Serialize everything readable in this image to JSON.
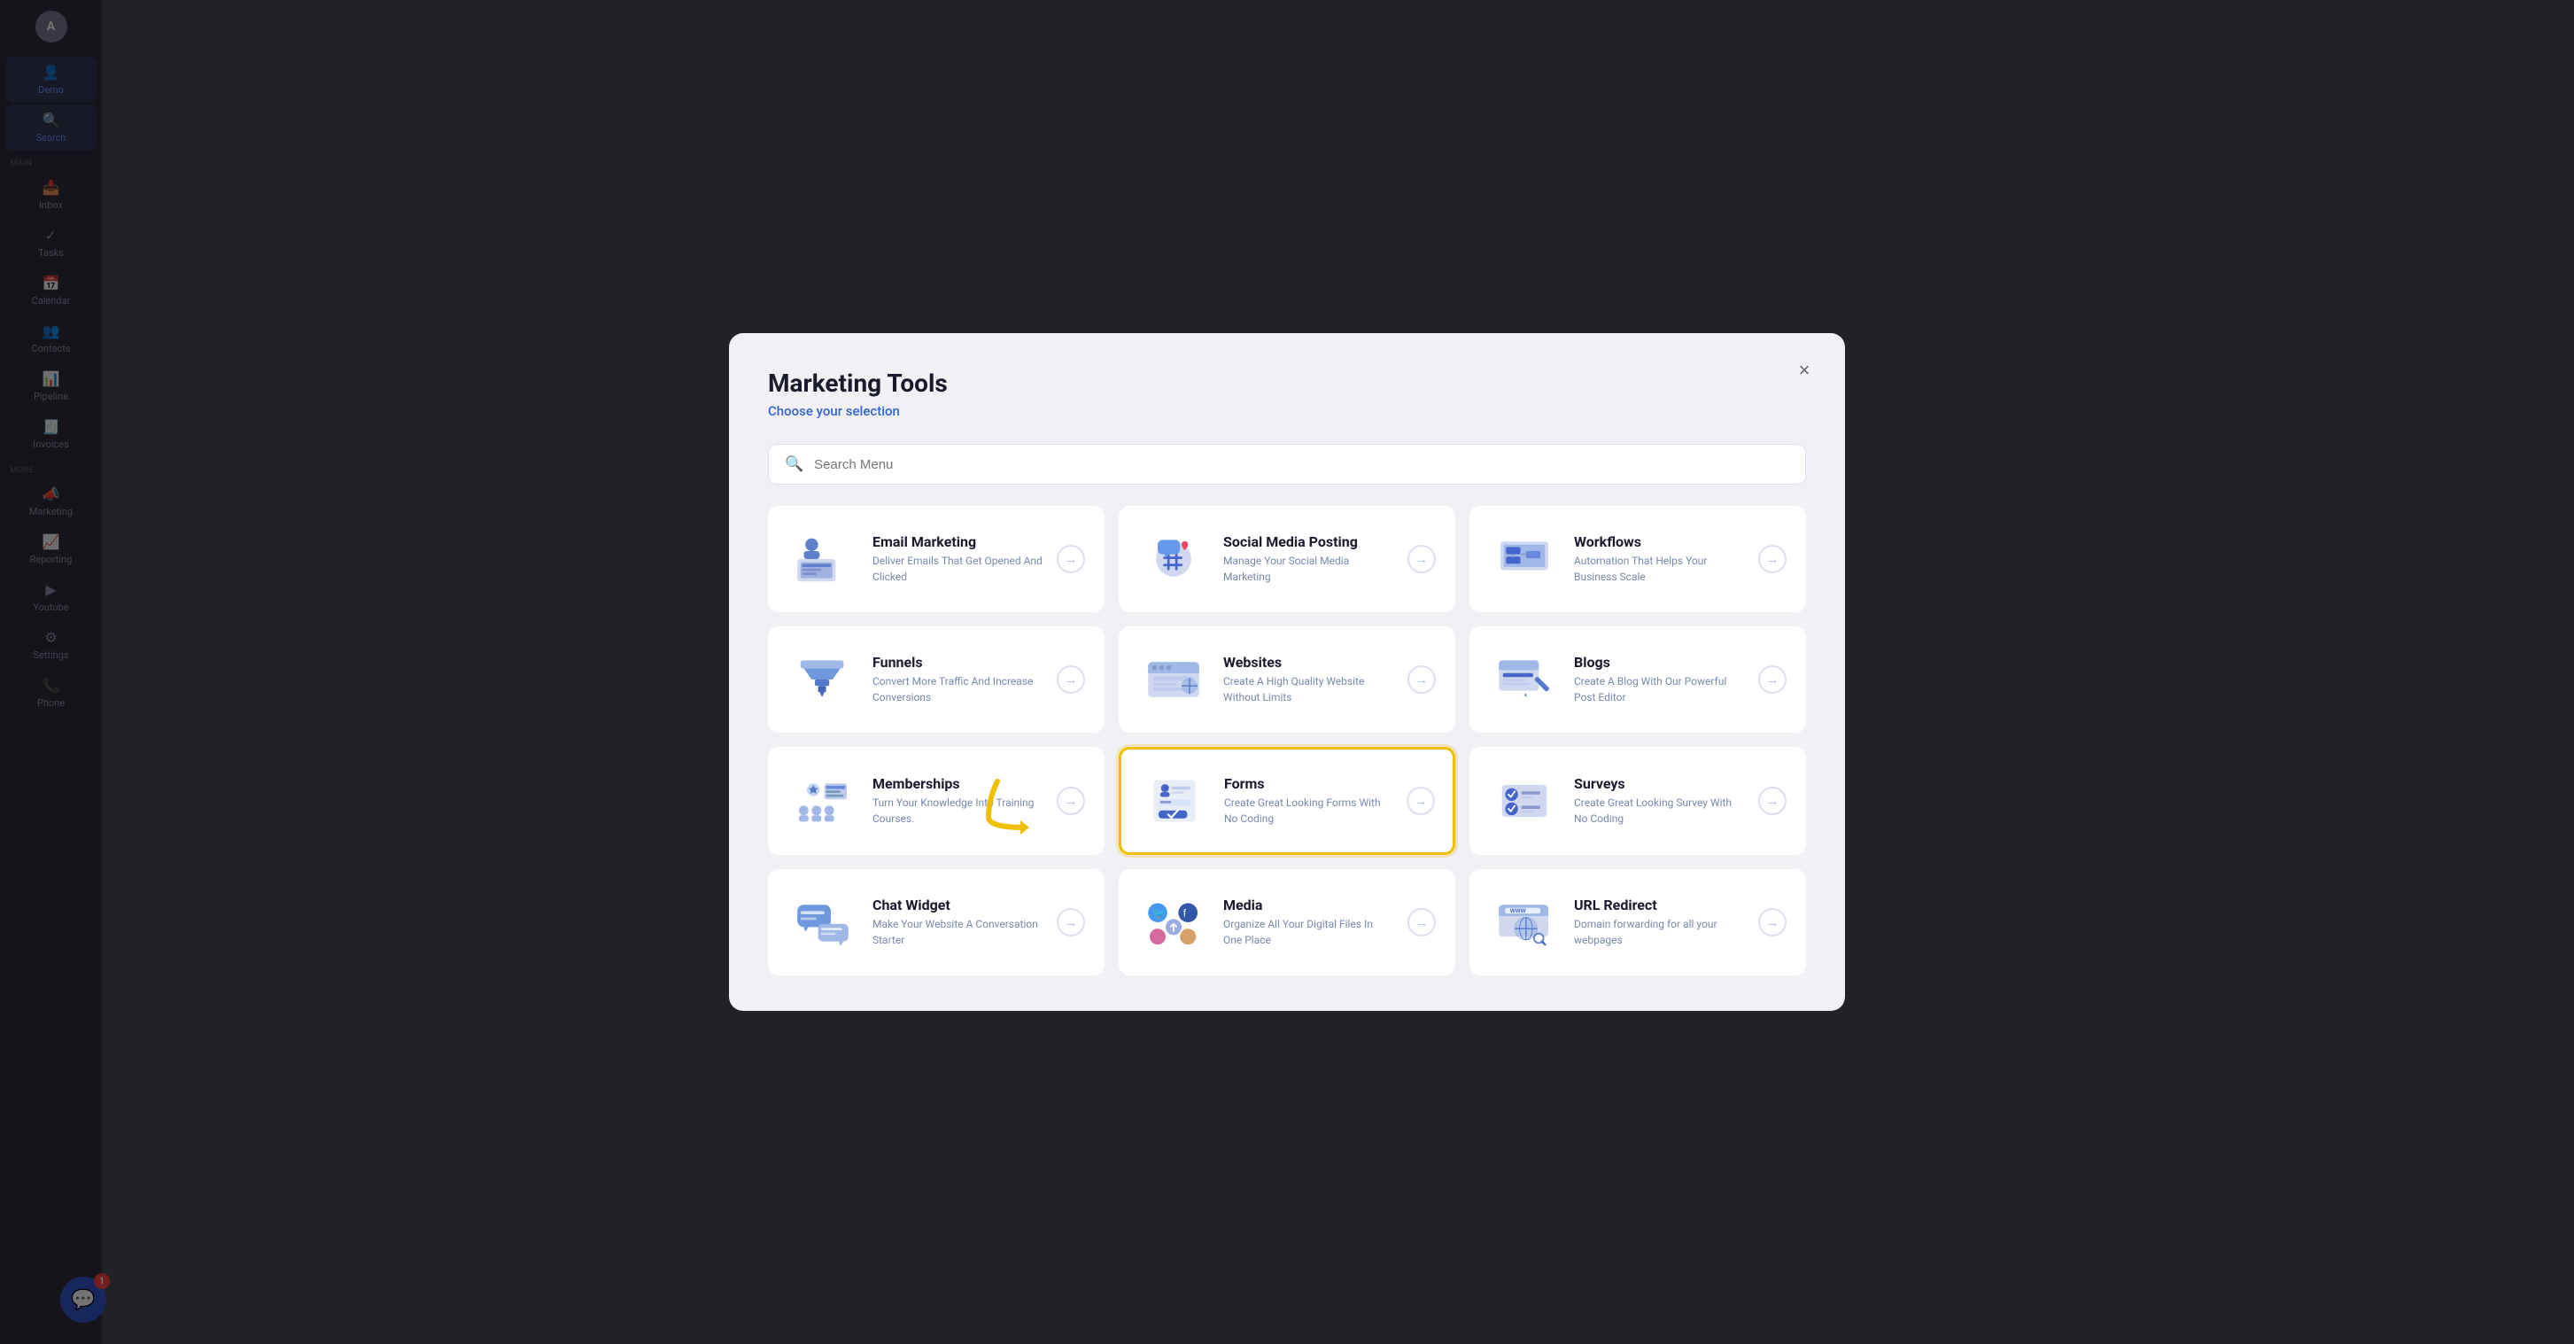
{
  "modal": {
    "title": "Marketing Tools",
    "subtitle": "Choose your selection",
    "close_label": "×"
  },
  "search": {
    "placeholder": "Search Menu"
  },
  "tools": [
    {
      "id": "email-marketing",
      "name": "Email Marketing",
      "desc": "Deliver Emails That Get Opened And Clicked",
      "arrow_label": "→",
      "icon_type": "email"
    },
    {
      "id": "social-media",
      "name": "Social Media Posting",
      "desc": "Manage Your Social Media Marketing",
      "arrow_label": "→",
      "icon_type": "social"
    },
    {
      "id": "workflows",
      "name": "Workflows",
      "desc": "Automation That Helps Your Business Scale",
      "arrow_label": "→",
      "icon_type": "workflows"
    },
    {
      "id": "funnels",
      "name": "Funnels",
      "desc": "Convert More Traffic And Increase Conversions",
      "arrow_label": "→",
      "icon_type": "funnels"
    },
    {
      "id": "websites",
      "name": "Websites",
      "desc": "Create A High Quality Website Without Limits",
      "arrow_label": "→",
      "icon_type": "websites"
    },
    {
      "id": "blogs",
      "name": "Blogs",
      "desc": "Create A Blog With Our Powerful Post Editor",
      "arrow_label": "→",
      "icon_type": "blogs"
    },
    {
      "id": "memberships",
      "name": "Memberships",
      "desc": "Turn Your Knowledge Into Training Courses.",
      "arrow_label": "→",
      "icon_type": "memberships"
    },
    {
      "id": "forms",
      "name": "Forms",
      "desc": "Create Great Looking Forms With No Coding",
      "arrow_label": "→",
      "icon_type": "forms",
      "highlighted": true
    },
    {
      "id": "surveys",
      "name": "Surveys",
      "desc": "Create Great Looking Survey With No Coding",
      "arrow_label": "→",
      "icon_type": "surveys"
    },
    {
      "id": "chat-widget",
      "name": "Chat Widget",
      "desc": "Make Your Website A Conversation Starter",
      "arrow_label": "→",
      "icon_type": "chat"
    },
    {
      "id": "media",
      "name": "Media",
      "desc": "Organize All Your Digital Files In One Place",
      "arrow_label": "→",
      "icon_type": "media"
    },
    {
      "id": "url-redirect",
      "name": "URL Redirect",
      "desc": "Domain forwarding for all your webpages",
      "arrow_label": "→",
      "icon_type": "url"
    }
  ],
  "sidebar": {
    "avatar": "A",
    "items": [
      {
        "label": "Demo",
        "icon": "👤"
      },
      {
        "label": "Search",
        "icon": "🔍",
        "active": true
      },
      {
        "label": "Inbox",
        "icon": "📥"
      },
      {
        "label": "Tasks",
        "icon": "✓"
      },
      {
        "label": "Calendar",
        "icon": "📅"
      },
      {
        "label": "Contacts",
        "icon": "👥"
      },
      {
        "label": "Pipeline",
        "icon": "📊"
      },
      {
        "label": "Invoices",
        "icon": "🧾"
      },
      {
        "label": "Marketing",
        "icon": "📣"
      },
      {
        "label": "Reporting",
        "icon": "📈"
      },
      {
        "label": "Youtube",
        "icon": "▶"
      },
      {
        "label": "Settings",
        "icon": "⚙"
      },
      {
        "label": "Phone",
        "icon": "📞"
      }
    ]
  },
  "chat_badge": "1"
}
